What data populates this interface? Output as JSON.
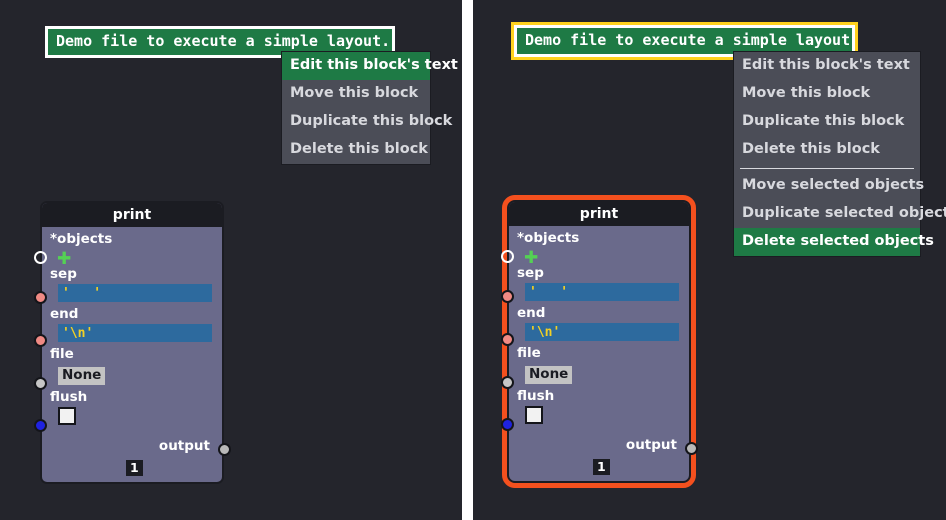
{
  "theme": {
    "canvas_bg": "#24252c",
    "divider": "#ffffff",
    "node_body": "#6a6a8b",
    "node_header": "#1b1c22",
    "menu_bg": "#4b4d57",
    "menu_text": "#d8d9de",
    "highlight_green": "#1e7a45",
    "selection_orange": "#f4501e",
    "selection_yellow": "#ffd21e",
    "value_field_blue": "#2d6a9e",
    "value_text_yellow": "#f2d024"
  },
  "panels": [
    {
      "id": "left",
      "banner": {
        "text": "Demo file to execute a simple layout.",
        "border_color": "#ffffff",
        "selected": false
      },
      "context_menu": {
        "groups": [
          {
            "items": [
              {
                "label": "Edit this block's text",
                "highlighted": true
              },
              {
                "label": "Move this block",
                "highlighted": false
              },
              {
                "label": "Duplicate this block",
                "highlighted": false
              },
              {
                "label": "Delete this block",
                "highlighted": false
              }
            ]
          }
        ]
      },
      "node": {
        "title": "print",
        "selected": false,
        "count_badge": "1",
        "output_label": "output",
        "inputs": [
          {
            "name": "*objects",
            "control": "add",
            "add_icon": "plus-icon",
            "socket": "empty"
          },
          {
            "name": "sep",
            "control": "text",
            "value": "'   '",
            "socket": "salmon"
          },
          {
            "name": "end",
            "control": "text",
            "value": "'\\n'",
            "socket": "salmon"
          },
          {
            "name": "file",
            "control": "none",
            "value": "None",
            "socket": "gray"
          },
          {
            "name": "flush",
            "control": "checkbox",
            "value": "",
            "socket": "blue"
          }
        ]
      }
    },
    {
      "id": "right",
      "banner": {
        "text": "Demo file to execute a simple layout.",
        "border_color": "#ffd21e",
        "selected": true
      },
      "context_menu": {
        "groups": [
          {
            "items": [
              {
                "label": "Edit this block's text",
                "highlighted": false
              },
              {
                "label": "Move this block",
                "highlighted": false
              },
              {
                "label": "Duplicate this block",
                "highlighted": false
              },
              {
                "label": "Delete this block",
                "highlighted": false
              }
            ]
          },
          {
            "items": [
              {
                "label": "Move selected objects",
                "highlighted": false
              },
              {
                "label": "Duplicate selected objects",
                "highlighted": false
              },
              {
                "label": "Delete selected objects",
                "highlighted": true
              }
            ]
          }
        ]
      },
      "node": {
        "title": "print",
        "selected": true,
        "count_badge": "1",
        "output_label": "output",
        "inputs": [
          {
            "name": "*objects",
            "control": "add",
            "add_icon": "plus-icon",
            "socket": "empty"
          },
          {
            "name": "sep",
            "control": "text",
            "value": "'   '",
            "socket": "salmon"
          },
          {
            "name": "end",
            "control": "text",
            "value": "'\\n'",
            "socket": "salmon"
          },
          {
            "name": "file",
            "control": "none",
            "value": "None",
            "socket": "gray"
          },
          {
            "name": "flush",
            "control": "checkbox",
            "value": "",
            "socket": "blue"
          }
        ]
      }
    }
  ]
}
